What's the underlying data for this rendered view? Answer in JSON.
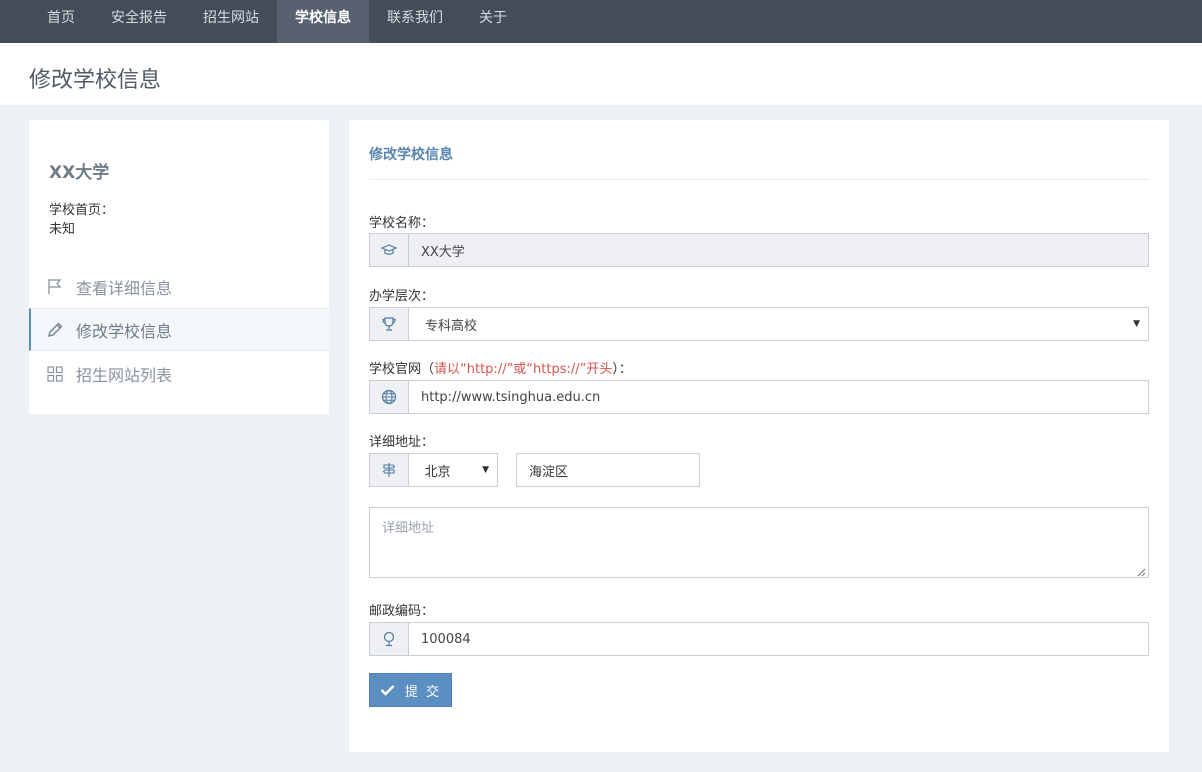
{
  "nav": {
    "items": [
      {
        "label": "首页"
      },
      {
        "label": "安全报告"
      },
      {
        "label": "招生网站"
      },
      {
        "label": "学校信息"
      },
      {
        "label": "联系我们"
      },
      {
        "label": "关于"
      }
    ],
    "active_index": 3
  },
  "page": {
    "title": "修改学校信息"
  },
  "sidebar": {
    "school_name": "XX大学",
    "home_label": "学校首页：",
    "home_value": "未知",
    "menu": [
      {
        "label": "查看详细信息",
        "icon": "flag-icon"
      },
      {
        "label": "修改学校信息",
        "icon": "pencil-icon"
      },
      {
        "label": "招生网站列表",
        "icon": "grid-icon"
      }
    ]
  },
  "form": {
    "title": "修改学校信息",
    "school_name": {
      "label": "学校名称：",
      "value": "XX大学",
      "icon": "graduation-cap-icon"
    },
    "level": {
      "label": "办学层次：",
      "value": "专科高校",
      "icon": "trophy-icon"
    },
    "website": {
      "label_prefix": "学校官网（",
      "label_hint": "请以“http://”或“https://”开头",
      "label_suffix": "）：",
      "value": "http://www.tsinghua.edu.cn",
      "icon": "globe-icon"
    },
    "address": {
      "label": "详细地址：",
      "province": "北京",
      "district": "海淀区",
      "detail_placeholder": "详细地址",
      "icon": "signpost-icon"
    },
    "postcode": {
      "label": "邮政编码：",
      "value": "100084",
      "icon": "location-pin-icon"
    },
    "submit_label": "提 交"
  },
  "colors": {
    "nav_bg": "#454c59",
    "accent": "#5b8fc1",
    "hint": "#d9534f"
  }
}
